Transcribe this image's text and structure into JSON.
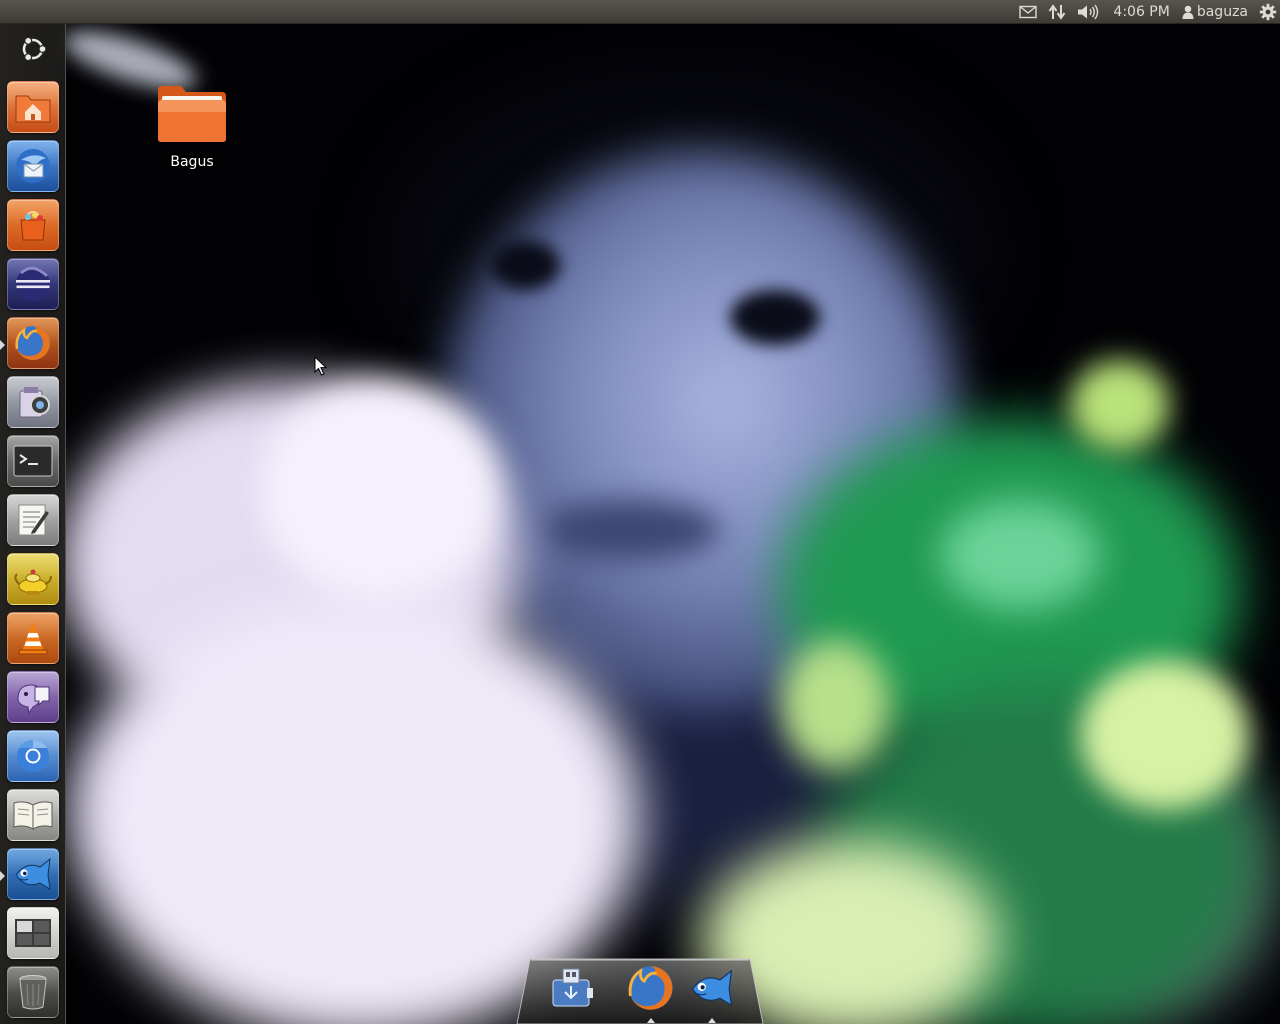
{
  "top_panel": {
    "indicators": [
      {
        "name": "mail-icon"
      },
      {
        "name": "network-icon"
      },
      {
        "name": "volume-icon"
      }
    ],
    "clock": "4:06 PM",
    "user_name": "baguza",
    "session_icon": "gear-icon"
  },
  "launcher": {
    "items": [
      {
        "name": "ubuntu-dash",
        "icon": "ubuntu-logo-icon"
      },
      {
        "name": "home-folder",
        "icon": "home-folder-icon"
      },
      {
        "name": "thunderbird",
        "icon": "thunderbird-icon"
      },
      {
        "name": "software-center",
        "icon": "software-center-icon"
      },
      {
        "name": "eclipse",
        "icon": "eclipse-icon"
      },
      {
        "name": "firefox",
        "icon": "firefox-icon",
        "running": true
      },
      {
        "name": "cheese-webcam",
        "icon": "webcam-icon"
      },
      {
        "name": "terminal",
        "icon": "terminal-icon"
      },
      {
        "name": "text-editor",
        "icon": "text-editor-icon"
      },
      {
        "name": "tea-genie",
        "icon": "genie-lamp-icon"
      },
      {
        "name": "vlc",
        "icon": "vlc-cone-icon"
      },
      {
        "name": "pidgin",
        "icon": "pidgin-icon"
      },
      {
        "name": "chromium",
        "icon": "chromium-icon"
      },
      {
        "name": "ebook-reader",
        "icon": "book-icon"
      },
      {
        "name": "emesene",
        "icon": "fish-icon",
        "running": true
      },
      {
        "name": "workspace-switcher",
        "icon": "workspaces-icon"
      },
      {
        "name": "trash",
        "icon": "trash-icon"
      }
    ]
  },
  "desktop": {
    "icons": [
      {
        "label": "Bagus",
        "icon": "folder-icon"
      }
    ]
  },
  "dock": {
    "items": [
      {
        "name": "save-device",
        "icon": "usb-drive-icon",
        "running": false
      },
      {
        "name": "firefox",
        "icon": "firefox-icon",
        "running": true
      },
      {
        "name": "emesene",
        "icon": "fish-icon",
        "running": true
      }
    ]
  },
  "colors": {
    "panel": "#3c3b37",
    "launcher": "#262421",
    "folder_orange": "#ef7431"
  }
}
